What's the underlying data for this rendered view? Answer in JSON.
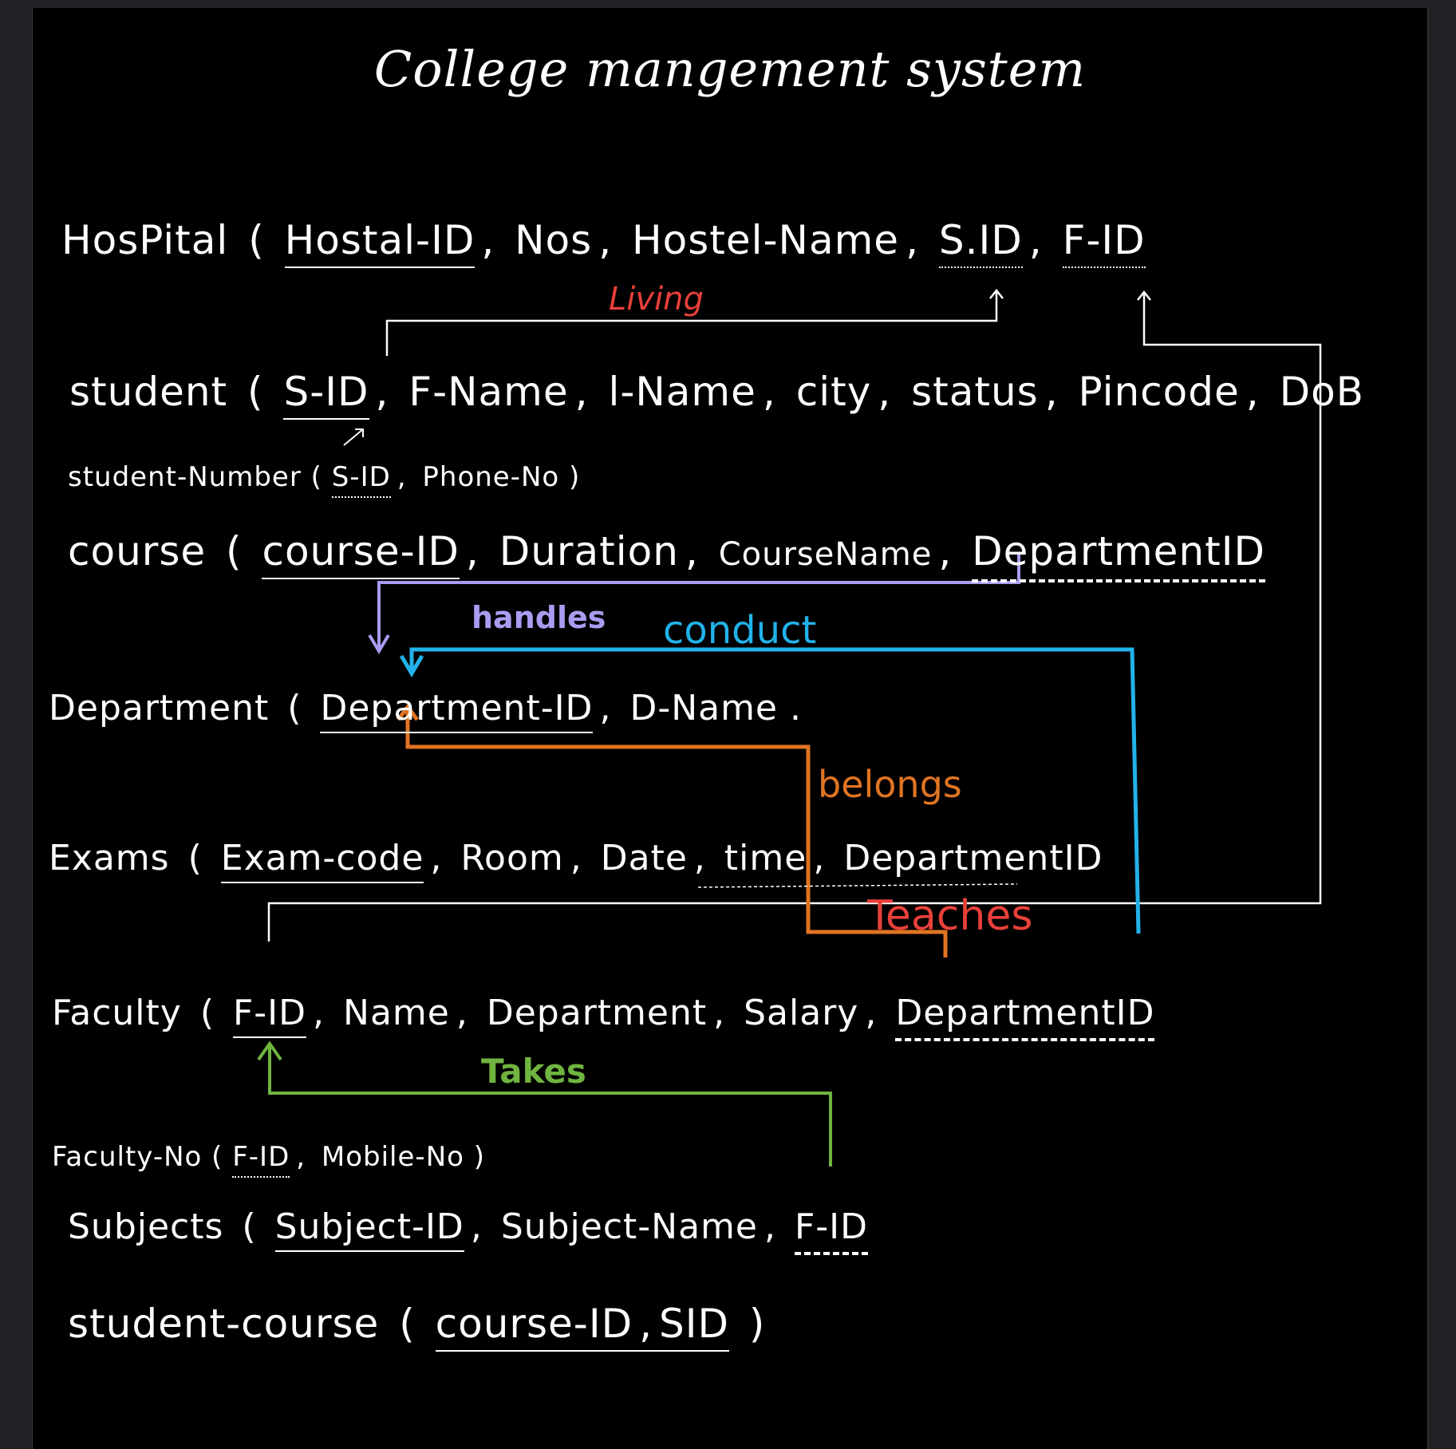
{
  "title": "College mangement system",
  "tables": {
    "hospital": {
      "name": "HosPital",
      "open": "(",
      "f1": "Hostal-ID",
      "f2": "Nos",
      "f3": "Hostel-Name",
      "f4": "S.ID",
      "f5": "F-ID"
    },
    "student": {
      "name": "student",
      "open": "(",
      "f1": "S-ID",
      "f2": "F-Name",
      "f3": "l-Name",
      "f4": "city",
      "f5": "status",
      "f6": "Pincode",
      "f7": "DoB"
    },
    "student_number": {
      "name": "student-Number",
      "open": "(",
      "f1": "S-ID",
      "f2": "Phone-No",
      "close": ")"
    },
    "course": {
      "name": "course",
      "open": "(",
      "f1": "course-ID",
      "f2": "Duration",
      "f3": "CourseName",
      "f4": "DepartmentID"
    },
    "department": {
      "name": "Department",
      "open": "(",
      "f1": "Department-ID",
      "f2": "D-Name",
      "f3": "."
    },
    "exams": {
      "name": "Exams",
      "open": "(",
      "f1": "Exam-code",
      "f2": "Room",
      "f3": "Date",
      "f4": "time",
      "f5": "DepartmentID"
    },
    "faculty": {
      "name": "Faculty",
      "open": "(",
      "f1": "F-ID",
      "f2": "Name",
      "f3": "Department",
      "f4": "Salary",
      "f5": "DepartmentID"
    },
    "faculty_no": {
      "name": "Faculty-No",
      "open": "(",
      "f1": "F-ID",
      "f2": "Mobile-No",
      "close": ")"
    },
    "subjects": {
      "name": "Subjects",
      "open": "(",
      "f1": "Subject-ID",
      "f2": "Subject-Name",
      "f3": "F-ID"
    },
    "student_course": {
      "name": "student-course",
      "open": "(",
      "f1": "course-ID",
      "f2": "SID",
      "close": ")"
    }
  },
  "relations": {
    "living": "Living",
    "handles": "handles",
    "conduct": "conduct",
    "belongs": "belongs",
    "teaches": "Teaches",
    "takes": "Takes"
  },
  "colors": {
    "living": "#e8403a",
    "handles": "#a99cf0",
    "conduct": "#22b2ea",
    "belongs": "#e07422",
    "teaches": "#e8403a",
    "takes": "#6fb43f",
    "white": "#ffffff"
  }
}
